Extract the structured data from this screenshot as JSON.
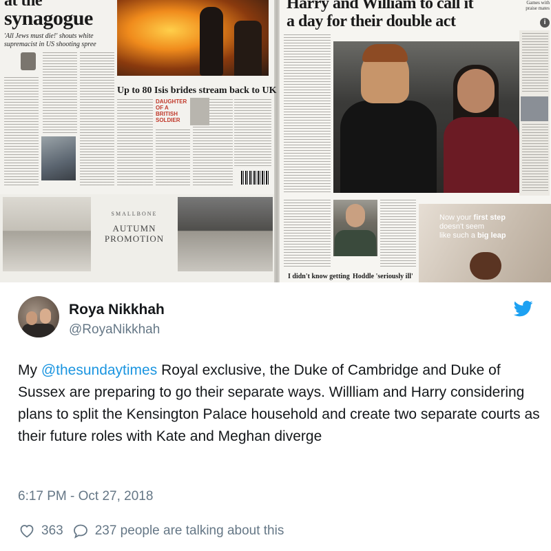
{
  "newspaper": {
    "left_headline_top": "at the",
    "left_headline": "synagogue",
    "left_subhead": "'All Jews must die!' shouts white supremacist in US shooting spree",
    "middle_headline": "Up to 80 Isis brides stream back to UK",
    "daughter_label": "DAUGHTER OF A BRITISH SOLDIER",
    "ad_brand": "SMALLBONE",
    "ad_title": "AUTUMN PROMOTION",
    "right_headline_line1": "Harry and William to call it",
    "right_headline_line2": "a day for their double act",
    "corner_text": "Games with praise mates",
    "bottom_head_1": "I didn't know getting",
    "bottom_head_2": "Hoddle 'seriously ill'",
    "ad2_text_1": "Now your ",
    "ad2_text_1b": "first step",
    "ad2_text_2": "doesn't seem",
    "ad2_text_3": "like such a ",
    "ad2_text_3b": "big leap"
  },
  "tweet": {
    "display_name": "Roya Nikkhah",
    "handle": "@RoyaNikkhah",
    "text_before_mention": "My ",
    "mention": "@thesundaytimes",
    "text_after_mention": " Royal exclusive, the Duke of Cambridge and Duke of Sussex are preparing to go their separate ways. Willliam and Harry considering plans to split the Kensington Palace household and create two separate courts as their future roles with Kate and Meghan diverge",
    "timestamp": "6:17 PM - Oct 27, 2018",
    "likes": "363",
    "replies_text": "237 people are talking about this",
    "icons": {
      "brand": "twitter-bird-icon",
      "like": "heart-icon",
      "reply": "speech-bubble-icon"
    },
    "colors": {
      "link": "#1b95e0",
      "muted": "#657786",
      "text": "#14171a"
    }
  }
}
